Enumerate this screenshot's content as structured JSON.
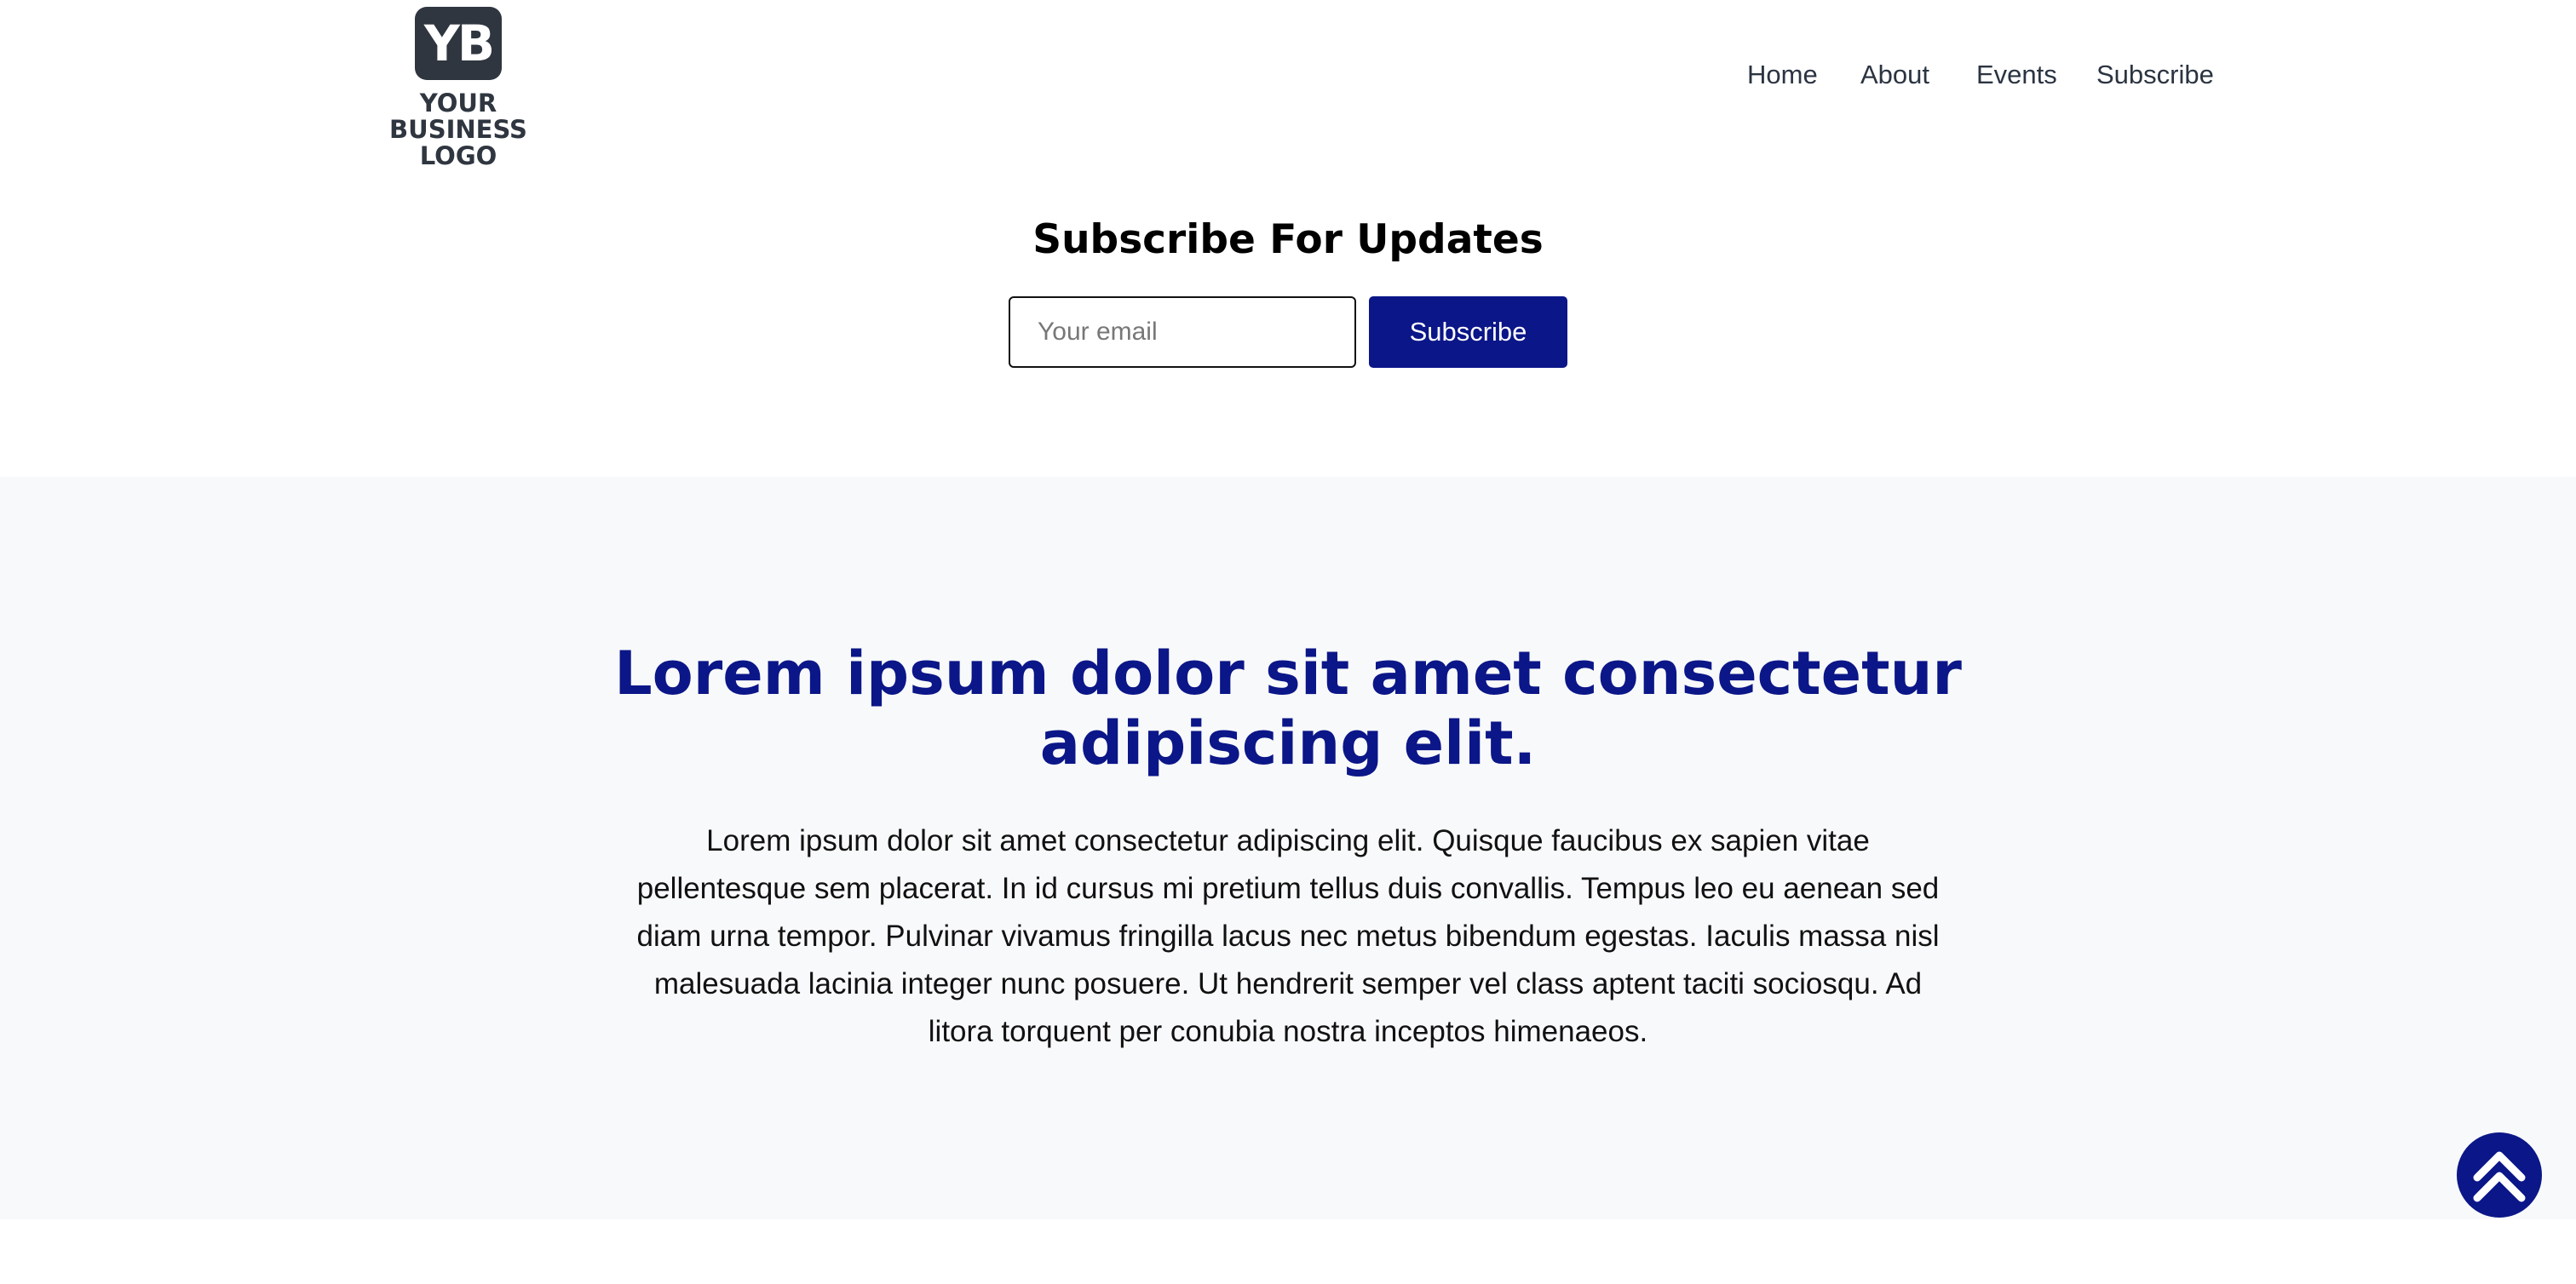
{
  "header": {
    "logo": {
      "initials": "YB",
      "text": "YOUR BUSINESS LOGO"
    },
    "nav": [
      {
        "label": "Home"
      },
      {
        "label": "About"
      },
      {
        "label": "Events"
      },
      {
        "label": "Subscribe"
      }
    ]
  },
  "subscribe": {
    "title": "Subscribe For Updates",
    "email_placeholder": "Your email",
    "button_label": "Subscribe"
  },
  "hero": {
    "title": "Lorem ipsum dolor sit amet consectetur adipiscing elit.",
    "body": "Lorem ipsum dolor sit amet consectetur adipiscing elit. Quisque faucibus ex sapien vitae pellentesque sem placerat. In id cursus mi pretium tellus duis convallis. Tempus leo eu aenean sed diam urna tempor. Pulvinar vivamus fringilla lacus nec metus bibendum egestas. Iaculis massa nisl malesuada lacinia integer nunc posuere. Ut hendrerit semper vel class aptent taciti sociosqu. Ad litora torquent per conubia nostra inceptos himenaeos."
  },
  "back_to_top": {
    "icon": "double-chevron-up-icon"
  },
  "colors": {
    "accent": "#0b1688",
    "logo": "#2f3640",
    "nav_text": "#2b3441",
    "section_bg": "#f8f9fa"
  }
}
